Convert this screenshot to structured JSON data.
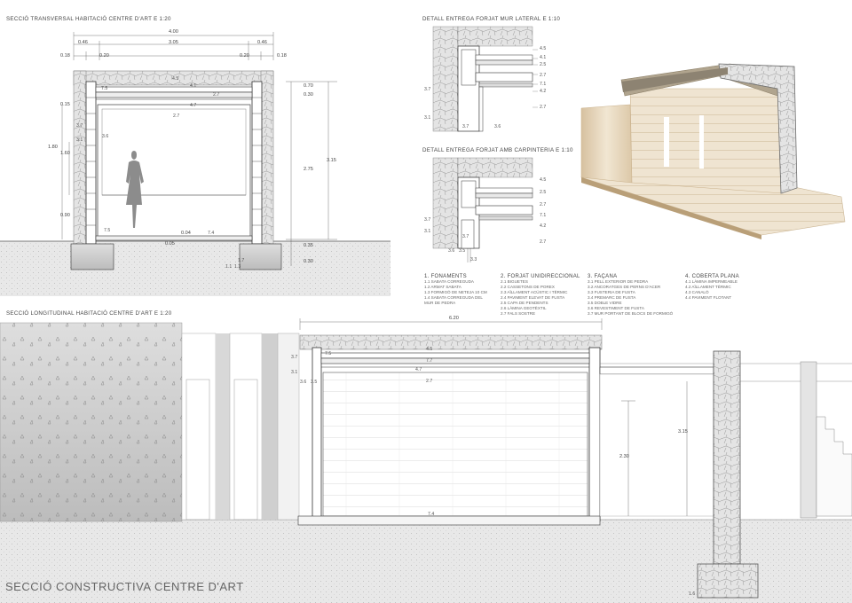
{
  "titles": {
    "transversal": "SECCIÓ TRANSVERSAL HABITACIÓ CENTRE D'ART E 1:20",
    "longitudinal": "SECCIÓ LONGITUDINAL HABITACIÓ CENTRE D'ART E 1:20",
    "detail_lateral": "DETALL ENTREGA FORJAT MUR LATERAL E 1:10",
    "detail_carpinteria": "DETALL ENTREGA FORJAT AMB CARPINTERIA E 1:10",
    "main": "SECCIÓ CONSTRUCTIVA CENTRE D'ART"
  },
  "transversal_dims": {
    "overall": "4.00",
    "left_wall": "0.46",
    "span": "3.05",
    "right_wall": "0.46",
    "left_outer": "0.18",
    "left_inner": "0.20",
    "right_inner": "0.20",
    "right_outer": "0.18",
    "top_070": "0.70",
    "top_030": "0.30",
    "height_275": "2.75",
    "height_315": "3.15",
    "bot_035": "0.35",
    "bot_030": "0.30",
    "left_015": "0.15",
    "left_180": "1.80",
    "left_160": "1.60",
    "left_090": "0.90",
    "floor_004": "0.04",
    "floor_005": "0.05"
  },
  "transversal_labels": [
    "4.5",
    "4.1",
    "7.5",
    "2.7",
    "4.7",
    "2.7",
    "3.6",
    "3.7",
    "3.1",
    "7.5",
    "7.4",
    "1.7",
    "1.1",
    "1.3"
  ],
  "detail1_labels": [
    "4.5",
    "4.1",
    "2.5",
    "2.7",
    "7.1",
    "4.2",
    "2.7",
    "3.7",
    "3.1",
    "3.7",
    "3.6"
  ],
  "detail2_labels": [
    "4.5",
    "2.5",
    "2.7",
    "7.1",
    "4.2",
    "2.7",
    "3.7",
    "3.1",
    "3.7",
    "3.6",
    "3.5",
    "3.3"
  ],
  "longitudinal_dims": {
    "length": "6.20",
    "h230": "2.30",
    "h315": "3.15",
    "floor": "7.4",
    "roof_45": "4.5",
    "roof_77": "7.7",
    "roof_47": "4.7",
    "roof_27": "2.7",
    "roof_75": "7.5",
    "left_37": "3.7",
    "left_31": "3.1",
    "left_36": "3.6",
    "left_35": "3.5",
    "bottom_16": "1.6"
  },
  "legend": [
    {
      "heading": "1. FONAMENTS",
      "items": [
        "1.1 SABATA CORREGUDA",
        "1.2 ARMAT SABATA",
        "1.3 FORMIGÓ DE NETEJA 10 CM",
        "1.4 SABATA CORREGUDA DEL MUR DE PEDRA"
      ]
    },
    {
      "heading": "2. FORJAT UNIDIRECCIONAL",
      "items": [
        "2.1 BIGUETES",
        "2.2 CASSETONS DE POREX",
        "2.3 AÏLLAMENT ACÚSTIC I TÈRMIC",
        "2.4 PAVIMENT ELEVAT DE FUSTA",
        "2.5 CAPA DE PENDENTS",
        "2.6 LÀMINA GEOTÈXTIL",
        "2.7 FALS SOSTRE"
      ]
    },
    {
      "heading": "3. FAÇANA",
      "items": [
        "3.1 PELL EXTERIOR DE PEDRA",
        "3.2 ANCORATGES DE PERNS D'ACER",
        "3.3 FUSTERIA DE FUSTA",
        "3.4 PREMARC DE FUSTA",
        "3.5 DOBLE VIDRE",
        "3.6 REVESTIMENT DE FUSTA",
        "3.7 MUR PORTANT DE BLOCS DE FORMIGÓ"
      ]
    },
    {
      "heading": "4. COBERTA PLANA",
      "items": [
        "4.1 LÀMINA IMPERMEABLE",
        "4.2 AÏLLAMENT TÈRMIC",
        "4.3 CANALÓ",
        "4.4 PAVIMENT FLOTANT"
      ]
    }
  ],
  "colors": {
    "ground": "#e6e6e6",
    "stone": "#dcdcdc",
    "wood": "#e9dcc7",
    "line": "#444444",
    "concrete": "#cfcfcf"
  }
}
